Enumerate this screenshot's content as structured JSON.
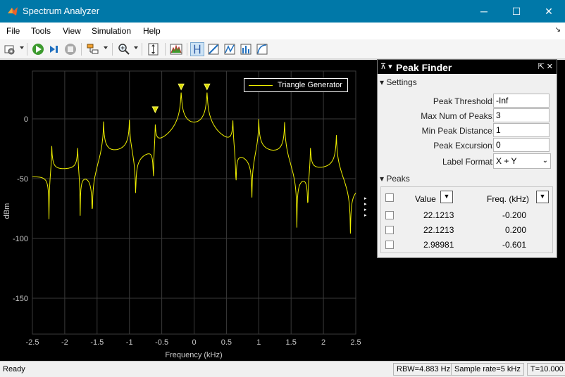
{
  "window": {
    "title": "Spectrum Analyzer",
    "minimize": "─",
    "maximize": "☐",
    "close": "✕"
  },
  "menu": [
    "File",
    "Tools",
    "View",
    "Simulation",
    "Help"
  ],
  "menu_dock_glyph": "↘",
  "toolbar_icons": [
    "settings-icon",
    "run-icon",
    "step-forward-icon",
    "stop-icon",
    "signal-select-icon",
    "zoom-icon",
    "scale-axes-icon",
    "spectrum-settings-icon",
    "data-cursors-icon",
    "distortion-icon",
    "peak-finder-icon",
    "ccdf-icon",
    "channel-measurements-icon"
  ],
  "plot": {
    "legend": "Triangle Generator",
    "ylabel": "dBm",
    "xlabel": "Frequency (kHz)",
    "yticks": [
      "0",
      "-50",
      "-100",
      "-150"
    ],
    "xticks": [
      "-2.5",
      "-2",
      "-1.5",
      "-1",
      "-0.5",
      "0",
      "0.5",
      "1",
      "1.5",
      "2",
      "2.5"
    ],
    "trace_color": "#f0f000"
  },
  "chart_data": {
    "type": "line",
    "series": [
      {
        "name": "Triangle Generator"
      }
    ],
    "xlabel": "Frequency (kHz)",
    "ylabel": "dBm",
    "xlim": [
      -2.5,
      2.5
    ],
    "ylim": [
      -180,
      40
    ],
    "peaks_dBm": [
      {
        "x": -2.2,
        "y": -27
      },
      {
        "x": -1.8,
        "y": -27
      },
      {
        "x": -1.4,
        "y": -6
      },
      {
        "x": -1.0,
        "y": -4
      },
      {
        "x": -0.6,
        "y": -7
      },
      {
        "x": -0.2,
        "y": 22
      },
      {
        "x": 0.2,
        "y": 22
      },
      {
        "x": 0.6,
        "y": -4
      },
      {
        "x": 1.0,
        "y": -4
      },
      {
        "x": 1.4,
        "y": -6
      },
      {
        "x": 1.8,
        "y": -27
      },
      {
        "x": 2.2,
        "y": -17
      }
    ],
    "marked_peaks": [
      {
        "x": -0.601,
        "y": 2.98981
      },
      {
        "x": -0.2,
        "y": 22.1213
      },
      {
        "x": 0.2,
        "y": 22.1213
      }
    ],
    "grid": true,
    "legend_position": "top-right"
  },
  "panel": {
    "pin": "⊼ ▾",
    "title": "Peak Finder",
    "buttons": "⇱ ✕",
    "settings_header": "▾ Settings",
    "settings": [
      {
        "label": "Peak Threshold:",
        "value": "-Inf"
      },
      {
        "label": "Max Num of Peaks:",
        "value": "3"
      },
      {
        "label": "Min Peak Distance:",
        "value": "1"
      },
      {
        "label": "Peak Excursion:",
        "value": "0"
      }
    ],
    "label_format": {
      "label": "Label Format:",
      "value": "X + Y"
    },
    "peaks_header": "▾ Peaks",
    "peaks_columns": {
      "value": "Value",
      "freq": "Freq. (kHz)",
      "filter_glyph": "▼"
    },
    "peaks_rows": [
      {
        "value": "22.1213",
        "freq": "-0.200"
      },
      {
        "value": "22.1213",
        "freq": "0.200"
      },
      {
        "value": "2.98981",
        "freq": "-0.601"
      }
    ]
  },
  "status": {
    "ready": "Ready",
    "rbw": "RBW=4.883 Hz",
    "sample_rate": "Sample rate=5 kHz",
    "time": "T=10.000"
  }
}
